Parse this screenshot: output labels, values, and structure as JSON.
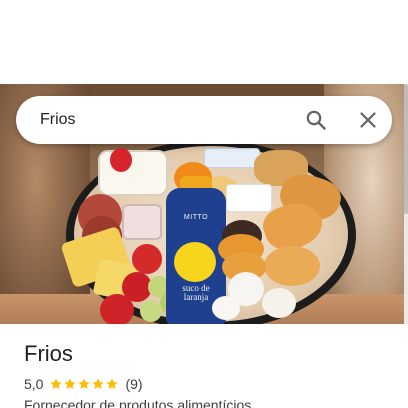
{
  "search": {
    "query": "Frios",
    "search_icon": "search-icon",
    "close_icon": "close-icon"
  },
  "hero": {
    "bottle_brand": "MITTO",
    "bottle_label": "suco de laranja"
  },
  "place": {
    "title": "Frios",
    "rating": "5,0",
    "stars": 5,
    "reviews": "(9)",
    "category": "Fornecedor de produtos alimentícios"
  },
  "colors": {
    "star": "#fbbc04",
    "icon": "#5f6368",
    "text": "#202124"
  }
}
